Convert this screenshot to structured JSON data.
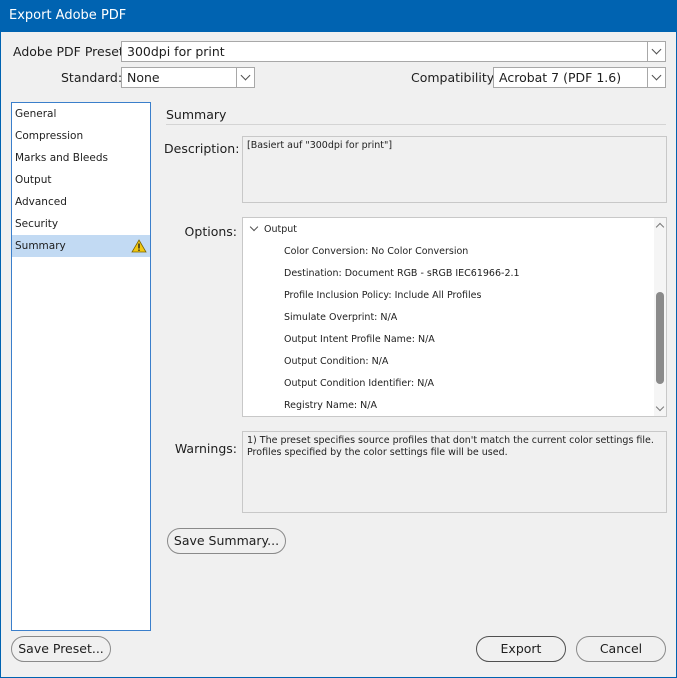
{
  "window": {
    "title": "Export Adobe PDF"
  },
  "preset": {
    "label": "Adobe PDF Preset:",
    "value": "300dpi for print"
  },
  "standard": {
    "label": "Standard:",
    "value": "None"
  },
  "compatibility": {
    "label": "Compatibility:",
    "value": "Acrobat 7 (PDF 1.6)"
  },
  "sidebar": {
    "items": [
      {
        "label": "General"
      },
      {
        "label": "Compression"
      },
      {
        "label": "Marks and Bleeds"
      },
      {
        "label": "Output"
      },
      {
        "label": "Advanced"
      },
      {
        "label": "Security"
      },
      {
        "label": "Summary",
        "selected": true,
        "warning_icon": "warning-triangle-icon"
      }
    ]
  },
  "summary": {
    "title": "Summary",
    "description_label": "Description:",
    "description": "[Basiert auf \"300dpi for print\"]",
    "options_label": "Options:",
    "options_group": "Output",
    "options": [
      "Color Conversion: No Color Conversion",
      "Destination: Document RGB - sRGB IEC61966-2.1",
      "Profile Inclusion Policy: Include All Profiles",
      "Simulate Overprint: N/A",
      "Output Intent Profile Name: N/A",
      "Output Condition: N/A",
      "Output Condition Identifier: N/A",
      "Registry Name: N/A"
    ],
    "warnings_label": "Warnings:",
    "warnings_line1": "1) The preset specifies source profiles that don't match the current color settings file.",
    "warnings_line2": "Profiles specified by the color settings file will be used."
  },
  "buttons": {
    "save_summary": "Save Summary...",
    "save_preset": "Save Preset...",
    "export": "Export",
    "cancel": "Cancel"
  },
  "colors": {
    "titlebar": "#0063b1",
    "selected": "#c2daf3",
    "warning": "#f2c811"
  }
}
